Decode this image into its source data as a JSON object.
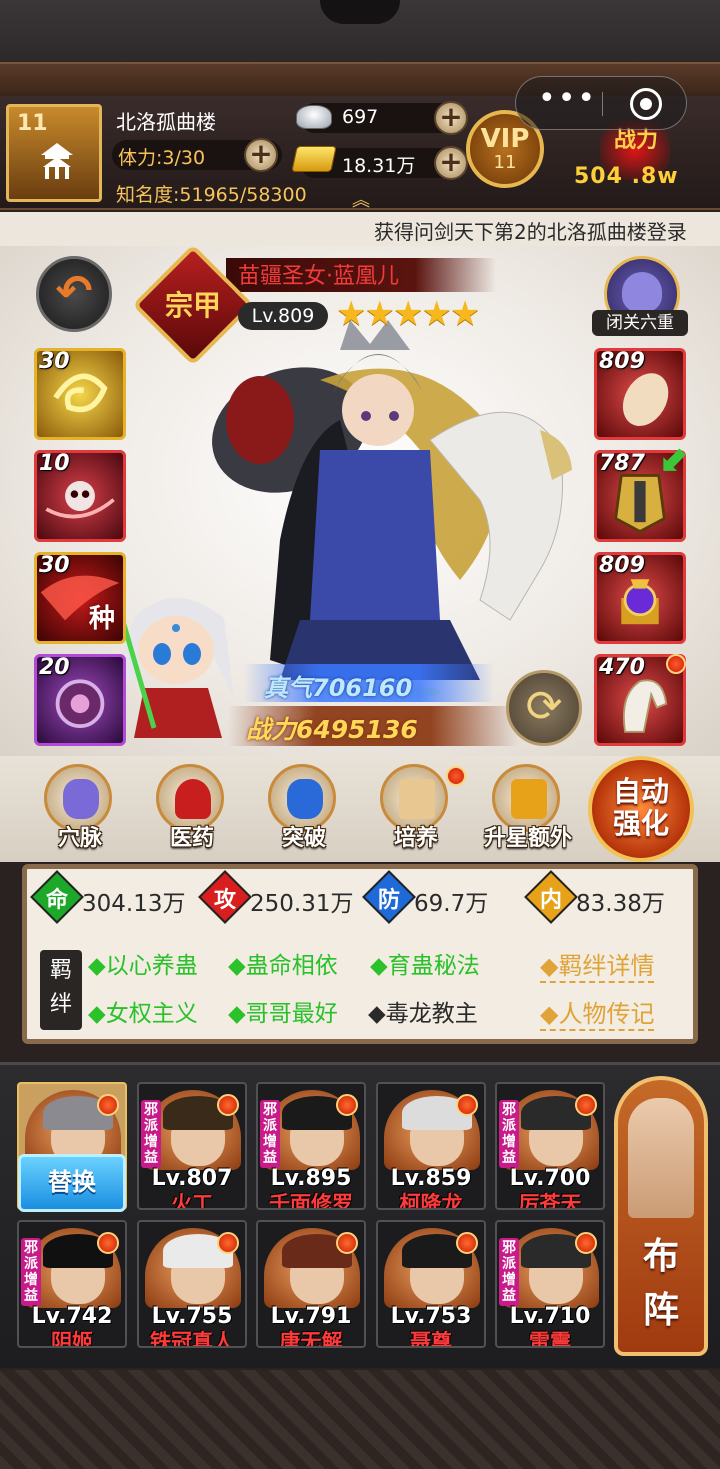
{
  "header": {
    "player_level": "11",
    "player_name": "北洛孤曲楼",
    "stamina": "体力:3/30",
    "fame": "知名度:51965/58300",
    "silver": "697",
    "gold": "18.31万",
    "vip_label": "VIP",
    "vip_level": "11",
    "power_label": "战力",
    "power_value": "504 .8w",
    "expand_icon": "chevron-up-double-icon"
  },
  "capsule": {
    "more_label": "•••",
    "close_icon": "target-icon"
  },
  "marquee": {
    "text": "获得问剑天下第2的北洛孤曲楼登录"
  },
  "hero": {
    "rank": "宗甲",
    "name": "苗疆圣女·蓝凰儿",
    "level": "Lv.809",
    "stars": 5,
    "stars_text": "★★★★★",
    "meditation_label": "闭关六重",
    "qi": "真气706160",
    "power": "战力6495136"
  },
  "skills": [
    {
      "level": "30",
      "char": "",
      "color": "#d9a21a"
    },
    {
      "level": "10",
      "char": "",
      "color": "#c81e2a"
    },
    {
      "level": "30",
      "char": "种",
      "color": "#b0141a"
    },
    {
      "level": "20",
      "char": "",
      "color": "#7a2a9a"
    }
  ],
  "equipment": [
    {
      "level": "809",
      "has_dot": false
    },
    {
      "level": "787",
      "has_dot": false
    },
    {
      "level": "809",
      "has_dot": false
    },
    {
      "level": "470",
      "has_dot": true
    }
  ],
  "functions": [
    {
      "label": "穴脉",
      "icon": "meridian-icon",
      "has_dot": false
    },
    {
      "label": "医药",
      "icon": "medicine-icon",
      "has_dot": false
    },
    {
      "label": "突破",
      "icon": "breakthrough-icon",
      "has_dot": false
    },
    {
      "label": "培养",
      "icon": "scroll-icon",
      "has_dot": true
    },
    {
      "label": "升星额外",
      "icon": "star-chest-icon",
      "has_dot": false
    }
  ],
  "auto_button": {
    "line1": "自动",
    "line2": "强化"
  },
  "stats": [
    {
      "char": "命",
      "value": "304.13万",
      "color": "#1ea82a"
    },
    {
      "char": "攻",
      "value": "250.31万",
      "color": "#d81e1e"
    },
    {
      "char": "防",
      "value": "69.7万",
      "color": "#1e6ad8"
    },
    {
      "char": "内",
      "value": "83.38万",
      "color": "#e8a21a"
    }
  ],
  "bonds": {
    "tag_line1": "羁",
    "tag_line2": "绊",
    "items": [
      {
        "text": "◆以心养蛊",
        "active": true
      },
      {
        "text": "◆蛊命相依",
        "active": true
      },
      {
        "text": "◆育蛊秘法",
        "active": true
      },
      {
        "text": "◆女权主义",
        "active": true
      },
      {
        "text": "◆哥哥最好",
        "active": true
      },
      {
        "text": "◆毒龙教主",
        "active": false
      }
    ],
    "detail_link": "◆羁绊详情",
    "bio_link": "◆人物传记"
  },
  "lineup": {
    "sect_tag": "邪派增益",
    "replace_label": "替换",
    "formation_line1": "布",
    "formation_line2": "阵",
    "row1": [
      {
        "level": "",
        "name": "",
        "sect": false,
        "hair": "#8a8a90"
      },
      {
        "level": "Lv.807",
        "name": "火工",
        "sect": true,
        "hair": "#3a2a1a"
      },
      {
        "level": "Lv.895",
        "name": "千面修罗",
        "sect": true,
        "hair": "#1a1a1a"
      },
      {
        "level": "Lv.859",
        "name": "柯降龙",
        "sect": false,
        "hair": "#dcdcdc"
      },
      {
        "level": "Lv.700",
        "name": "厉苍天",
        "sect": true,
        "hair": "#2a2a2a"
      }
    ],
    "row2": [
      {
        "level": "Lv.742",
        "name": "阴姬",
        "sect": true,
        "hair": "#101010"
      },
      {
        "level": "Lv.755",
        "name": "铁冠真人",
        "sect": false,
        "hair": "#eaeaea"
      },
      {
        "level": "Lv.791",
        "name": "唐无解",
        "sect": false,
        "hair": "#6a2a1a"
      },
      {
        "level": "Lv.753",
        "name": "聂尊",
        "sect": false,
        "hair": "#1a1a1a"
      },
      {
        "level": "Lv.710",
        "name": "雷震",
        "sect": true,
        "hair": "#2a2a2a"
      }
    ]
  }
}
